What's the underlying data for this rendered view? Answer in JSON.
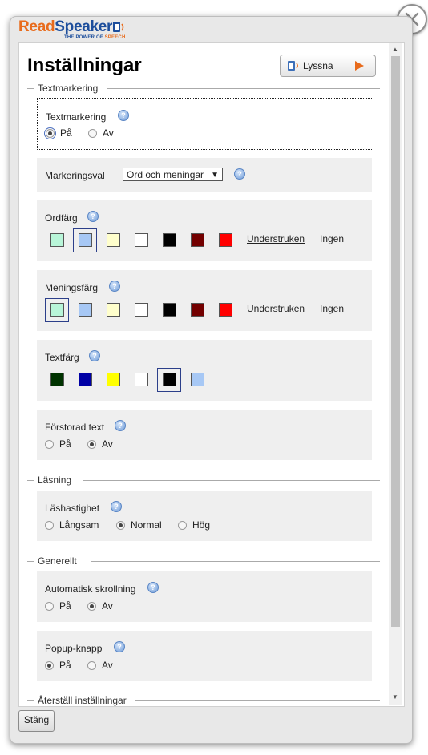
{
  "brand": {
    "name_part1": "Read",
    "name_part2": "Speaker",
    "tagline_part1": "THE POWER OF ",
    "tagline_part2": "SPEECH"
  },
  "header": {
    "title": "Inställningar",
    "listen_label": "Lyssna"
  },
  "sections": {
    "textmarkering": "Textmarkering",
    "lasning": "Läsning",
    "generellt": "Generellt",
    "aterstall": "Återställ inställningar"
  },
  "settings": {
    "textmarkering": {
      "label": "Textmarkering",
      "on": "På",
      "off": "Av",
      "selected": "on"
    },
    "markeringsval": {
      "label": "Markeringsval",
      "selected": "Ord och meningar"
    },
    "ordfarg": {
      "label": "Ordfärg",
      "colors": [
        "#b8f5d8",
        "#a7c8f5",
        "#ffffcc",
        "#ffffff",
        "#000000",
        "#730000",
        "#ff0000"
      ],
      "selected_index": 1,
      "underline": "Understruken",
      "none": "Ingen"
    },
    "meningsfarg": {
      "label": "Meningsfärg",
      "colors": [
        "#b8f5d8",
        "#a7c8f5",
        "#ffffcc",
        "#ffffff",
        "#000000",
        "#730000",
        "#ff0000"
      ],
      "selected_index": 0,
      "underline": "Understruken",
      "none": "Ingen"
    },
    "textfarg": {
      "label": "Textfärg",
      "colors": [
        "#003300",
        "#0000a5",
        "#ffff00",
        "#ffffff",
        "#000000",
        "#a7c8f5"
      ],
      "selected_index": 4
    },
    "forstorad": {
      "label": "Förstorad text",
      "on": "På",
      "off": "Av",
      "selected": "off"
    },
    "lashastighet": {
      "label": "Läshastighet",
      "slow": "Långsam",
      "normal": "Normal",
      "fast": "Hög",
      "selected": "normal"
    },
    "autoscroll": {
      "label": "Automatisk skrollning",
      "on": "På",
      "off": "Av",
      "selected": "off"
    },
    "popup": {
      "label": "Popup-knapp",
      "on": "På",
      "off": "Av",
      "selected": "on"
    }
  },
  "footer": {
    "close_label": "Stäng"
  }
}
